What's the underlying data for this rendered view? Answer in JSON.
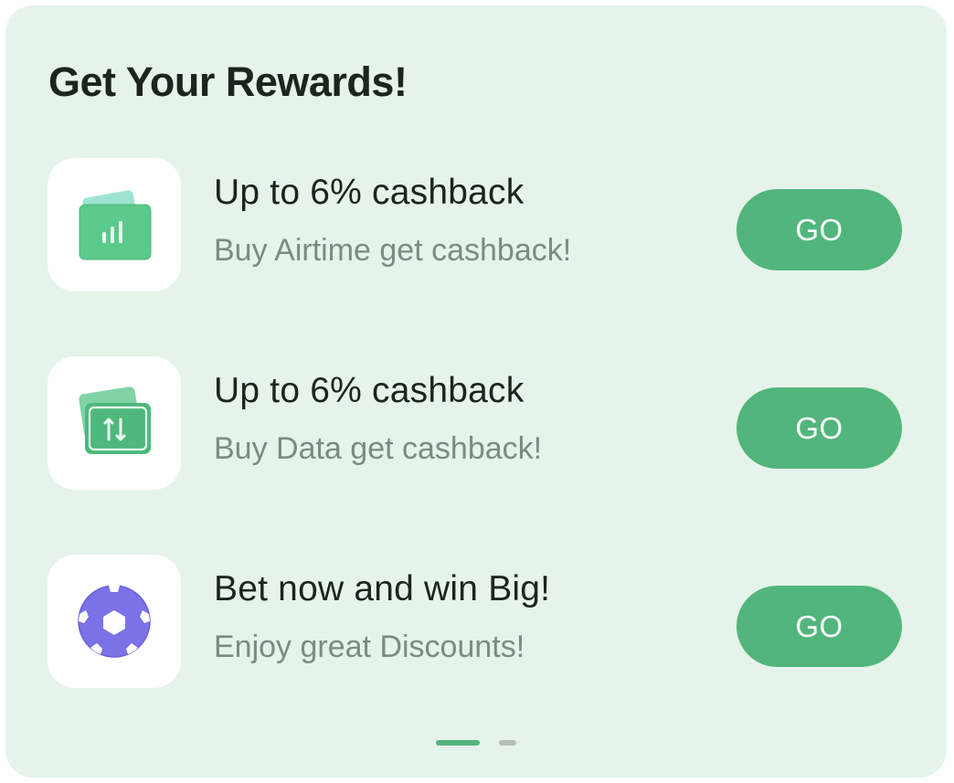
{
  "card": {
    "title": "Get Your Rewards!"
  },
  "rewards": [
    {
      "icon": "airtime-card-icon",
      "title": "Up to 6% cashback",
      "subtitle": "Buy Airtime get cashback!",
      "button_label": "GO"
    },
    {
      "icon": "data-card-icon",
      "title": "Up to 6% cashback",
      "subtitle": "Buy Data get cashback!",
      "button_label": "GO"
    },
    {
      "icon": "soccer-ball-icon",
      "title": "Bet now and win Big!",
      "subtitle": "Enjoy great Discounts!",
      "button_label": "GO"
    }
  ],
  "pager": {
    "pages": 2,
    "active_page": 1
  },
  "colors": {
    "card_background": "#e5f3ea",
    "accent": "#52b57c",
    "title_text": "#1c241f",
    "subtitle_text": "#7d8a82",
    "ball": "#7a72e6"
  }
}
